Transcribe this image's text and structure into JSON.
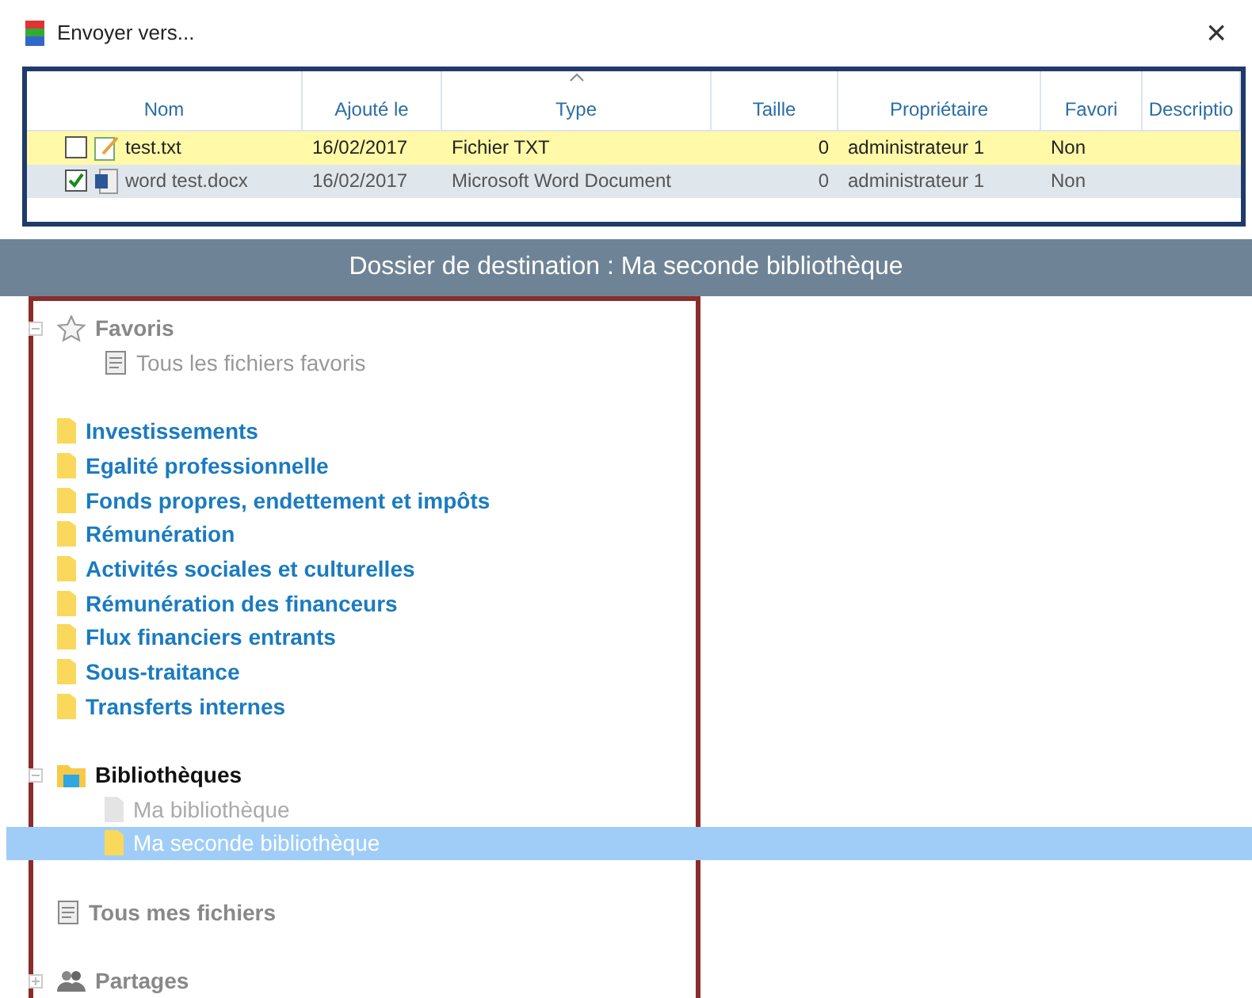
{
  "window": {
    "title": "Envoyer vers...",
    "close": "×"
  },
  "table": {
    "columns": [
      {
        "label": "Nom",
        "sorted": false
      },
      {
        "label": "Ajouté le",
        "sorted": false
      },
      {
        "label": "Type",
        "sorted": true
      },
      {
        "label": "Taille",
        "sorted": false
      },
      {
        "label": "Propriétaire",
        "sorted": false
      },
      {
        "label": "Favori",
        "sorted": false
      },
      {
        "label": "Descriptio",
        "sorted": false
      }
    ],
    "rows": [
      {
        "kind": "text",
        "selected": true,
        "checked": false,
        "cells": [
          "test.txt",
          "16/02/2017",
          "Fichier TXT",
          "0",
          "administrateur 1",
          "Non"
        ]
      },
      {
        "kind": "word",
        "selected": false,
        "checked": true,
        "cells": [
          "word test.docx",
          "16/02/2017",
          "Microsoft Word Document",
          "0",
          "administrateur 1",
          "Non"
        ]
      }
    ]
  },
  "destination": "Dossier de destination : Ma seconde bibliothèque",
  "tree": [
    {
      "kind": "favorites",
      "label": "Favoris",
      "selected": false,
      "expanded": true,
      "children": [
        {
          "kind": "document",
          "label": "Tous les fichiers favoris",
          "selected": false
        }
      ]
    },
    {
      "kind": "folder",
      "label": "Investissements",
      "selected": false
    },
    {
      "kind": "folder",
      "label": "Egalité professionnelle",
      "selected": false
    },
    {
      "kind": "folder",
      "label": "Fonds propres, endettement et impôts",
      "selected": false
    },
    {
      "kind": "folder",
      "label": "Rémunération",
      "selected": false
    },
    {
      "kind": "folder",
      "label": "Activités sociales et culturelles",
      "selected": false
    },
    {
      "kind": "folder",
      "label": "Rémunération des financeurs",
      "selected": false
    },
    {
      "kind": "folder",
      "label": "Flux financiers entrants",
      "selected": false
    },
    {
      "kind": "folder",
      "label": "Sous-traitance",
      "selected": false
    },
    {
      "kind": "folder",
      "label": "Transferts internes",
      "selected": false
    },
    {
      "kind": "libraries",
      "label": "Bibliothèques",
      "selected": false,
      "expanded": true,
      "children": [
        {
          "kind": "library",
          "label": "Ma bibliothèque",
          "selected": false,
          "disabled": true
        },
        {
          "kind": "library",
          "label": "Ma seconde bibliothèque",
          "selected": true,
          "disabled": false
        }
      ]
    },
    {
      "kind": "all-files",
      "label": "Tous mes fichiers",
      "selected": false
    },
    {
      "kind": "shares",
      "label": "Partages",
      "selected": false,
      "expanded": false
    }
  ]
}
